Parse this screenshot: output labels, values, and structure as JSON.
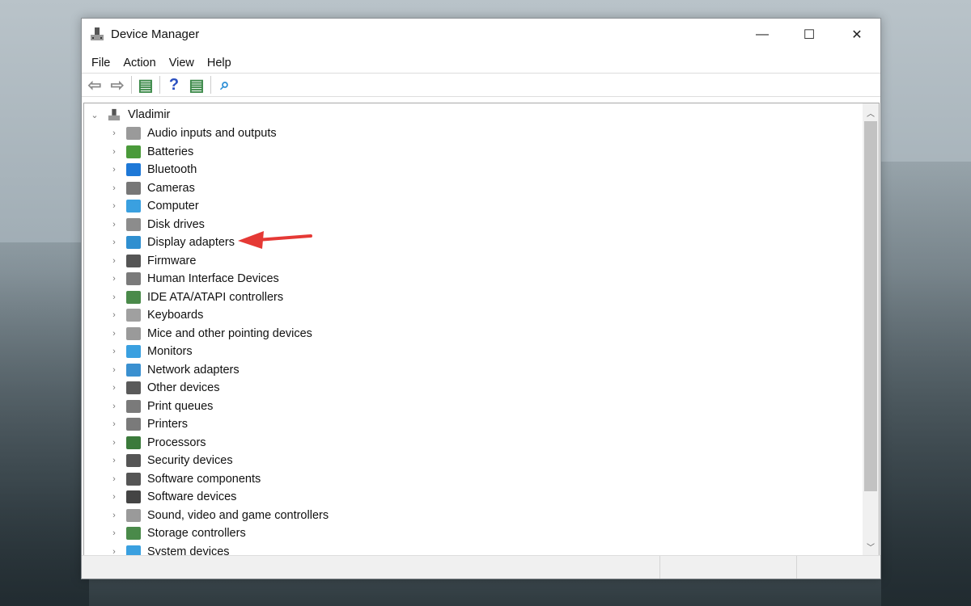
{
  "window": {
    "title": "Device Manager",
    "minimize": "—",
    "maximize": "☐",
    "close": "✕"
  },
  "menu": [
    "File",
    "Action",
    "View",
    "Help"
  ],
  "toolbar": [
    {
      "name": "back-icon",
      "glyph": "⇦",
      "color": "#8a8a8a"
    },
    {
      "name": "forward-icon",
      "glyph": "⇨",
      "color": "#8a8a8a"
    },
    {
      "sep": true
    },
    {
      "name": "show-hide-console-tree-icon",
      "glyph": "▤",
      "color": "#3d8a4a"
    },
    {
      "sep": true
    },
    {
      "name": "help-icon",
      "glyph": "?",
      "color": "#2a4fc0"
    },
    {
      "name": "properties-icon",
      "glyph": "▤",
      "color": "#3d8a4a"
    },
    {
      "sep": true
    },
    {
      "name": "scan-hardware-icon",
      "glyph": "⌕",
      "color": "#2d8fd6"
    }
  ],
  "tree": {
    "root": "Vladimir",
    "items": [
      {
        "label": "Audio inputs and outputs",
        "color": "#9a9a9a"
      },
      {
        "label": "Batteries",
        "color": "#4a9a3a"
      },
      {
        "label": "Bluetooth",
        "color": "#1e78d7"
      },
      {
        "label": "Cameras",
        "color": "#777777"
      },
      {
        "label": "Computer",
        "color": "#3aa0e0"
      },
      {
        "label": "Disk drives",
        "color": "#8c8c8c"
      },
      {
        "label": "Display adapters",
        "color": "#2f8fd0"
      },
      {
        "label": "Firmware",
        "color": "#555555"
      },
      {
        "label": "Human Interface Devices",
        "color": "#7a7a7a"
      },
      {
        "label": "IDE ATA/ATAPI controllers",
        "color": "#4a8a4a"
      },
      {
        "label": "Keyboards",
        "color": "#a0a0a0"
      },
      {
        "label": "Mice and other pointing devices",
        "color": "#9a9a9a"
      },
      {
        "label": "Monitors",
        "color": "#3aa0e0"
      },
      {
        "label": "Network adapters",
        "color": "#3a90d0"
      },
      {
        "label": "Other devices",
        "color": "#5a5a5a"
      },
      {
        "label": "Print queues",
        "color": "#7a7a7a"
      },
      {
        "label": "Printers",
        "color": "#7a7a7a"
      },
      {
        "label": "Processors",
        "color": "#3b7a3b"
      },
      {
        "label": "Security devices",
        "color": "#555555"
      },
      {
        "label": "Software components",
        "color": "#555555"
      },
      {
        "label": "Software devices",
        "color": "#444444"
      },
      {
        "label": "Sound, video and game controllers",
        "color": "#9a9a9a"
      },
      {
        "label": "Storage controllers",
        "color": "#4a8a4a"
      },
      {
        "label": "System devices",
        "color": "#3aa0e0"
      }
    ]
  },
  "annotation": {
    "color": "#e53935"
  }
}
